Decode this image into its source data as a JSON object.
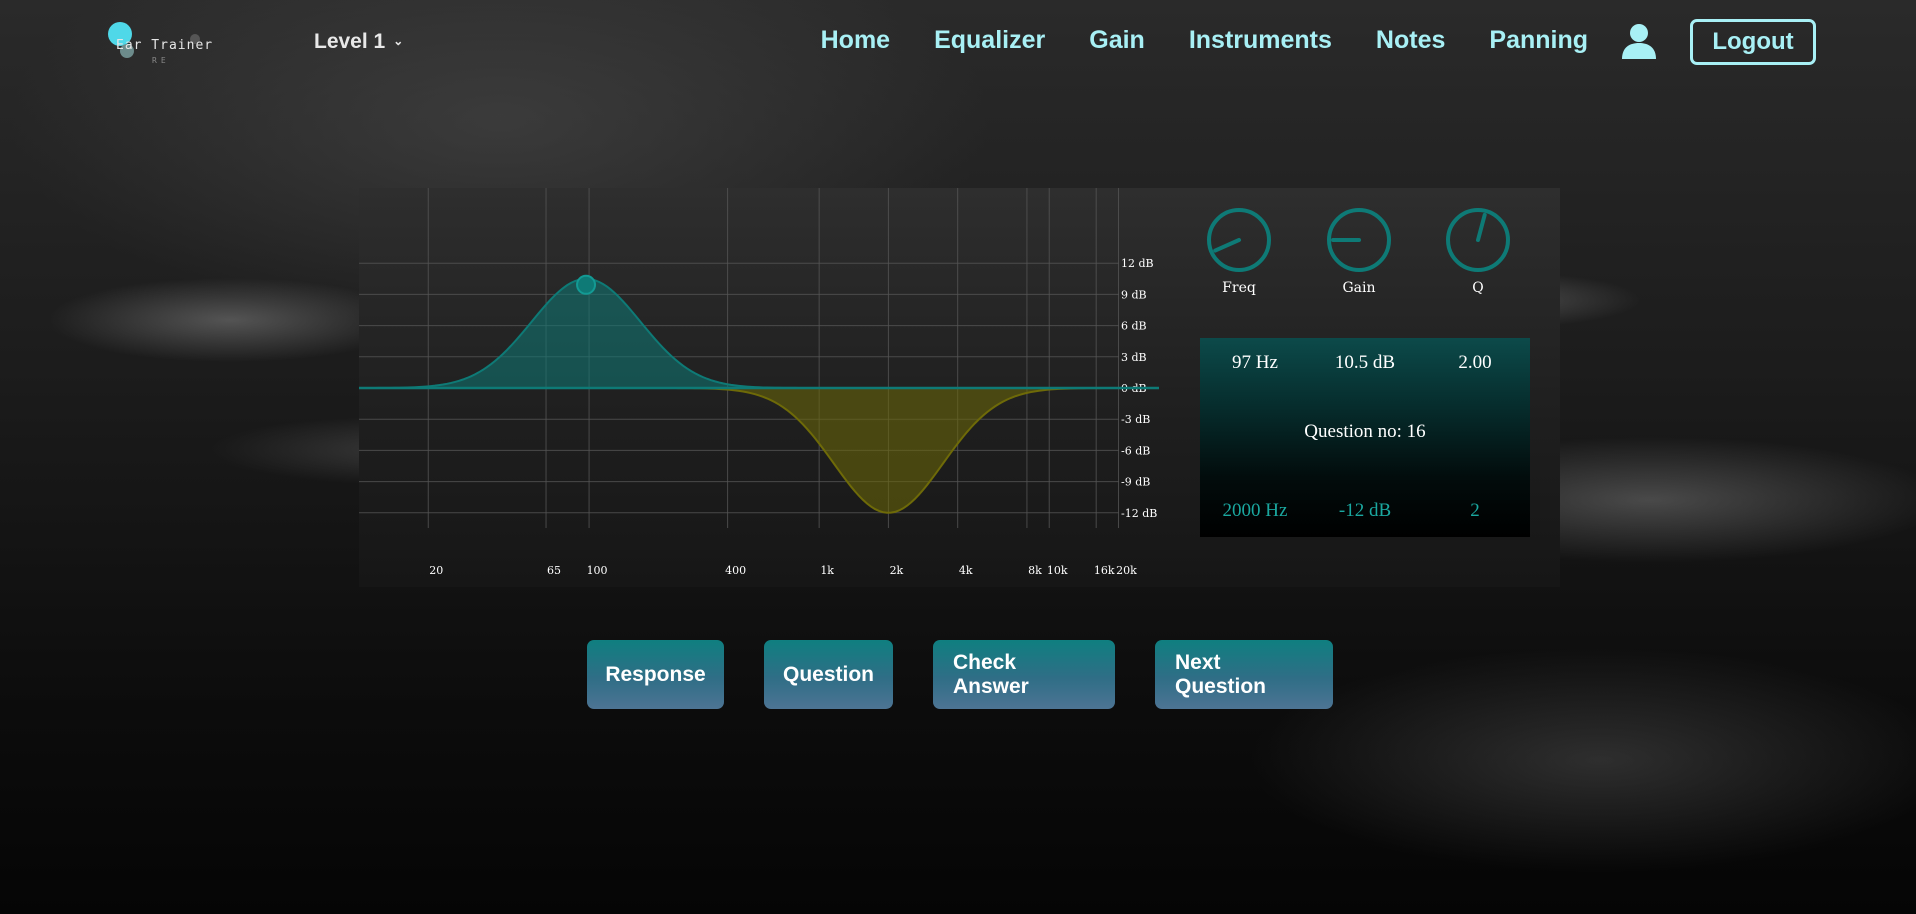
{
  "app": {
    "logo_text": "Ear Trainer",
    "logo_sub": "RE",
    "level_label": "Level 1"
  },
  "nav": [
    {
      "label": "Home"
    },
    {
      "label": "Equalizer"
    },
    {
      "label": "Gain"
    },
    {
      "label": "Instruments"
    },
    {
      "label": "Notes"
    },
    {
      "label": "Panning"
    }
  ],
  "header": {
    "logout_label": "Logout",
    "user_icon": "user-icon"
  },
  "knobs": [
    {
      "label": "Freq",
      "level": 0.12
    },
    {
      "label": "Gain",
      "level": 0.2
    },
    {
      "label": "Q",
      "level": 0.55
    }
  ],
  "readout": {
    "current": {
      "freq": "97 Hz",
      "gain": "10.5 dB",
      "q": "2.00"
    },
    "question_text": "Question no: 16",
    "answer": {
      "freq": "2000 Hz",
      "gain": "-12 dB",
      "q": "2"
    }
  },
  "eq": {
    "db_ticks": [
      "12 dB",
      "9 dB",
      "6 dB",
      "3 dB",
      "0 dB",
      "-3 dB",
      "-6 dB",
      "-9 dB",
      "-12 dB"
    ],
    "freq_ticks": [
      "20",
      "65",
      "100",
      "400",
      "1k",
      "2k",
      "4k",
      "8k",
      "10k",
      "16k",
      "20k"
    ],
    "user_band": {
      "freq_hz": 97,
      "gain_db": 10.5,
      "q": 2.0
    },
    "target_band": {
      "freq_hz": 2000,
      "gain_db": -12,
      "q": 2
    },
    "colors": {
      "user": "#0e7a76",
      "target": "#6e6a08",
      "grid": "#555555"
    }
  },
  "buttons": [
    {
      "label": "Response"
    },
    {
      "label": "Question"
    },
    {
      "label": "Check Answer"
    },
    {
      "label": "Next Question"
    }
  ]
}
